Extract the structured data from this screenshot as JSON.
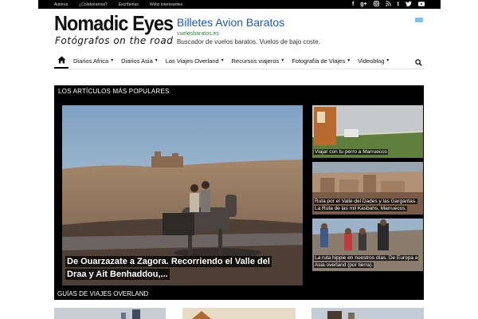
{
  "topbar": {
    "links": [
      "Autores",
      "¿Colaboramos?",
      "Escríbenos",
      "Webs interesantes"
    ],
    "social_icons": [
      "facebook-icon",
      "google-plus-icon",
      "instagram-icon",
      "rss-icon",
      "tumblr-icon",
      "twitter-icon",
      "youtube-icon"
    ]
  },
  "header": {
    "logo_title": "Nomadic Eyes",
    "logo_subtitle": "Fotógrafos on the road"
  },
  "ad": {
    "title": "Billetes Avion Baratos",
    "url": "vuelosbaratos.es",
    "description": "Buscador de vuelos baratos. Vuelos de bajo coste."
  },
  "nav": {
    "items": [
      {
        "label": "Diarios Africa"
      },
      {
        "label": "Diarios Asia"
      },
      {
        "label": "Los Viajes Overland"
      },
      {
        "label": "Recursos viajeros"
      },
      {
        "label": "Fotografía de Viajes"
      },
      {
        "label": "Videoblog"
      }
    ]
  },
  "popular": {
    "title": "LOS ARTÍCULOS MÁS POPULARES",
    "main": {
      "caption": "De Ouarzazate a Zagora. Recorriendo el Valle del Draa y Ait Benhaddou,..."
    },
    "side": [
      {
        "caption": "Viajar con tu perro a Marruecos"
      },
      {
        "caption": "Ruta por el Valle del Dades y las Gargantas. La Ruta de las mil Kasbahs, Marruecos."
      },
      {
        "caption": "La ruta hippie en nuestros días. De Europa a Asia overland (por tierra)."
      }
    ]
  },
  "overland": {
    "title": "GUÍAS DE VIAJES OVERLAND"
  },
  "colors": {
    "accent": "#000000",
    "ad_title": "#1a56c9",
    "ad_url": "#2a8a3a"
  }
}
